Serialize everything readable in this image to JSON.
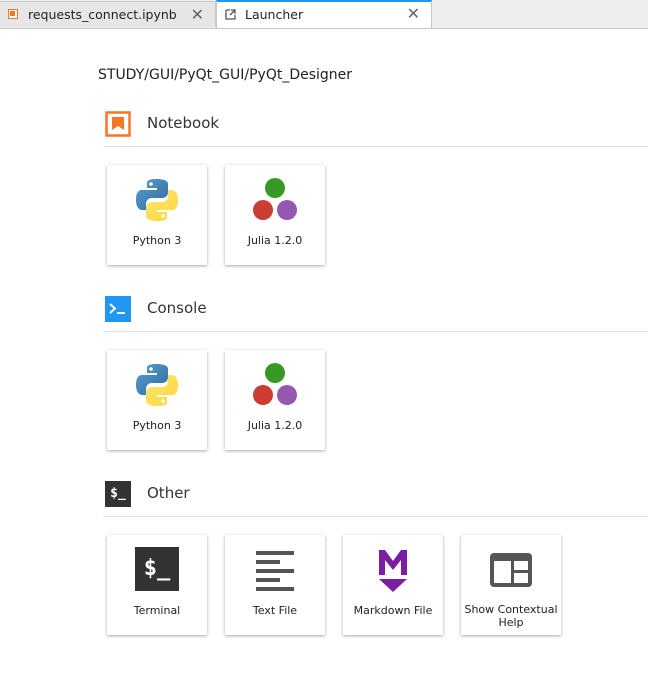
{
  "tabs": [
    {
      "label": "requests_connect.ipynb",
      "close": "✕",
      "active": false
    },
    {
      "label": "Launcher",
      "close": "✕",
      "active": true
    }
  ],
  "launcher": {
    "path": "STUDY/GUI/PyQt_GUI/PyQt_Designer",
    "sections": {
      "notebook": {
        "title": "Notebook",
        "cards": [
          {
            "label": "Python 3",
            "icon": "python-logo-icon"
          },
          {
            "label": "Julia 1.2.0",
            "icon": "julia-logo-icon"
          }
        ]
      },
      "console": {
        "title": "Console",
        "cards": [
          {
            "label": "Python 3",
            "icon": "python-logo-icon"
          },
          {
            "label": "Julia 1.2.0",
            "icon": "julia-logo-icon"
          }
        ]
      },
      "other": {
        "title": "Other",
        "icon_text": "$_",
        "cards": [
          {
            "label": "Terminal",
            "icon": "terminal-icon",
            "icon_text": "$_"
          },
          {
            "label": "Text File",
            "icon": "text-file-icon"
          },
          {
            "label": "Markdown File",
            "icon": "markdown-icon"
          },
          {
            "label": "Show Contextual Help",
            "icon": "contextual-help-icon"
          }
        ]
      }
    }
  },
  "colors": {
    "notebook_orange": "#f37726",
    "console_blue": "#2196f3",
    "other_dark": "#333333",
    "markdown_purple": "#7b1fa2",
    "julia_green": "#389826",
    "julia_red": "#cb3c33",
    "julia_purple": "#9558b2",
    "python_blue": "#3776ab",
    "python_yellow": "#ffd43b"
  }
}
